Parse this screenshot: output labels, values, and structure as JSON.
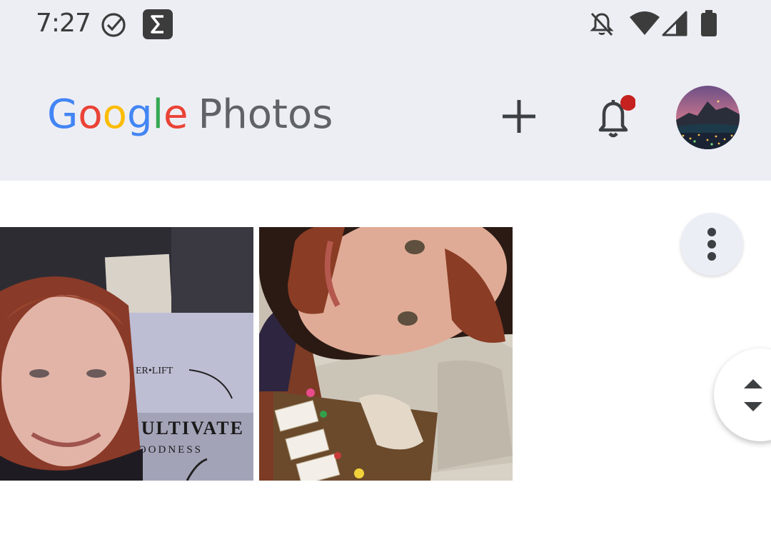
{
  "status_bar": {
    "time": "7:27",
    "icons": [
      "check-circle-icon",
      "sigma-app-icon",
      "notifications-off-icon",
      "wifi-icon",
      "signal-icon",
      "battery-icon"
    ]
  },
  "app_bar": {
    "logo_letters": [
      "G",
      "o",
      "o",
      "g",
      "l",
      "e"
    ],
    "logo_product": "Photos",
    "actions": [
      "add-icon",
      "notification-bell-icon",
      "account-avatar"
    ],
    "notification_dot_color": "#c5221f"
  },
  "grid": {
    "photos": [
      {
        "name": "selfie-with-sign",
        "sign_text_top": "ER•LIFT",
        "sign_text_main": "CULTIVATE",
        "sign_text_sub": "GOODNESS"
      },
      {
        "name": "selfie-with-gift-bags"
      }
    ]
  },
  "floating": {
    "more_options": "more-vert-icon",
    "fast_scroll": "scroll-updown-icon"
  },
  "colors": {
    "app_bar_bg": "#edeef4",
    "accent_blue": "#4285f4"
  }
}
